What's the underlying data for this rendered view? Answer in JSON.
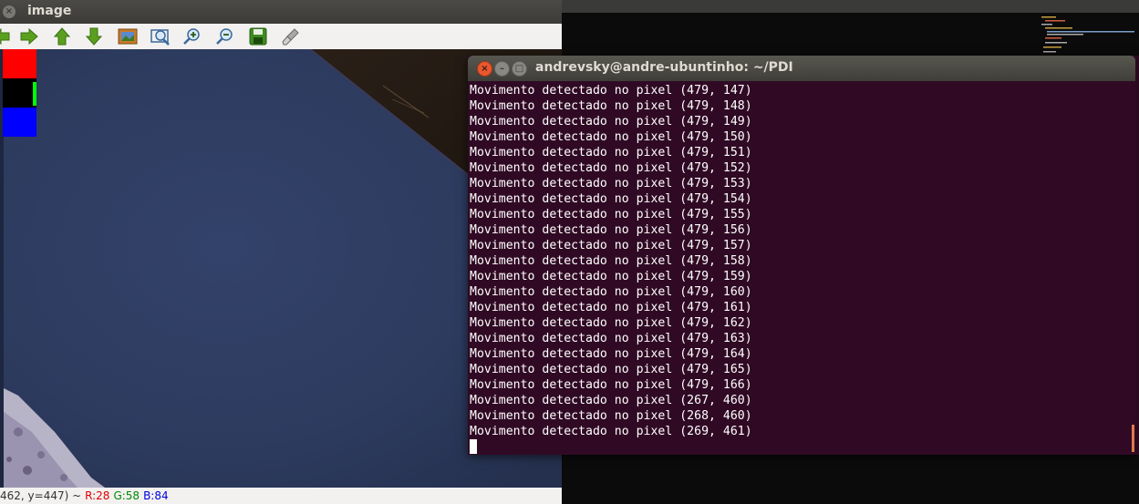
{
  "image_window": {
    "title": "image",
    "close_symbol": "×",
    "toolbar": [
      {
        "name": "pan-left-icon"
      },
      {
        "name": "pan-right-icon"
      },
      {
        "name": "pan-up-icon"
      },
      {
        "name": "pan-down-icon"
      },
      {
        "name": "zoom-fit-icon"
      },
      {
        "name": "zoom-region-icon"
      },
      {
        "name": "zoom-in-icon"
      },
      {
        "name": "zoom-out-icon"
      },
      {
        "name": "save-icon"
      },
      {
        "name": "properties-icon"
      }
    ],
    "status": {
      "coords": "462, y=447) ~",
      "r": "R:28",
      "g": "G:58",
      "b": "B:84"
    },
    "swatches": [
      "#ff0000",
      "#000000",
      "#0000ff"
    ]
  },
  "terminal": {
    "title": "andrevsky@andre-ubuntinho: ~/PDI",
    "close_symbol": "×",
    "min_symbol": "–",
    "max_symbol": "□",
    "lines": [
      "Movimento detectado no pixel (479, 147)",
      "Movimento detectado no pixel (479, 148)",
      "Movimento detectado no pixel (479, 149)",
      "Movimento detectado no pixel (479, 150)",
      "Movimento detectado no pixel (479, 151)",
      "Movimento detectado no pixel (479, 152)",
      "Movimento detectado no pixel (479, 153)",
      "Movimento detectado no pixel (479, 154)",
      "Movimento detectado no pixel (479, 155)",
      "Movimento detectado no pixel (479, 156)",
      "Movimento detectado no pixel (479, 157)",
      "Movimento detectado no pixel (479, 158)",
      "Movimento detectado no pixel (479, 159)",
      "Movimento detectado no pixel (479, 160)",
      "Movimento detectado no pixel (479, 161)",
      "Movimento detectado no pixel (479, 162)",
      "Movimento detectado no pixel (479, 163)",
      "Movimento detectado no pixel (479, 164)",
      "Movimento detectado no pixel (479, 165)",
      "Movimento detectado no pixel (479, 166)",
      "Movimento detectado no pixel (267, 460)",
      "Movimento detectado no pixel (268, 460)",
      "Movimento detectado no pixel (269, 461)"
    ]
  },
  "colors": {
    "terminal_bg": "#300a24",
    "titlebar": "#3c3b37",
    "close_button": "#e9572f",
    "accent_scroll": "#e07a4c"
  }
}
